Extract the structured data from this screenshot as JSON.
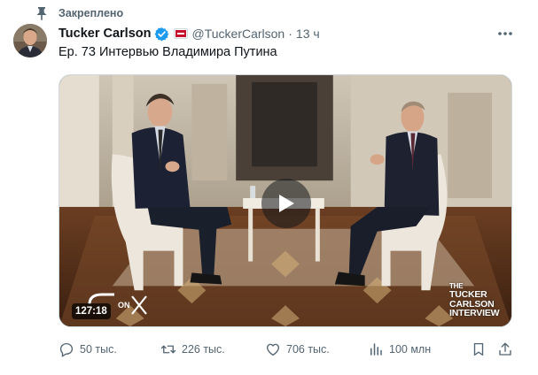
{
  "pinned": {
    "label": "Закреплено",
    "icon": "pin-icon"
  },
  "author": {
    "name": "Tucker Carlson",
    "handle": "@TuckerCarlson",
    "separator": "·",
    "time": "13 ч",
    "verified_color": "#1d9bf0"
  },
  "tweet": {
    "text": "Ep. 73 Интервью Владимира Путина"
  },
  "media": {
    "duration": "127:18",
    "watermark_lines": [
      "THE",
      "TUCKER",
      "CARLSON",
      "INTERVIEW"
    ]
  },
  "actions": {
    "replies": "50 тыс.",
    "reposts": "226 тыс.",
    "likes": "706 тыс.",
    "views": "100 млн"
  },
  "colors": {
    "accent": "#1d9bf0",
    "muted": "#536471",
    "text": "#0f1419"
  }
}
